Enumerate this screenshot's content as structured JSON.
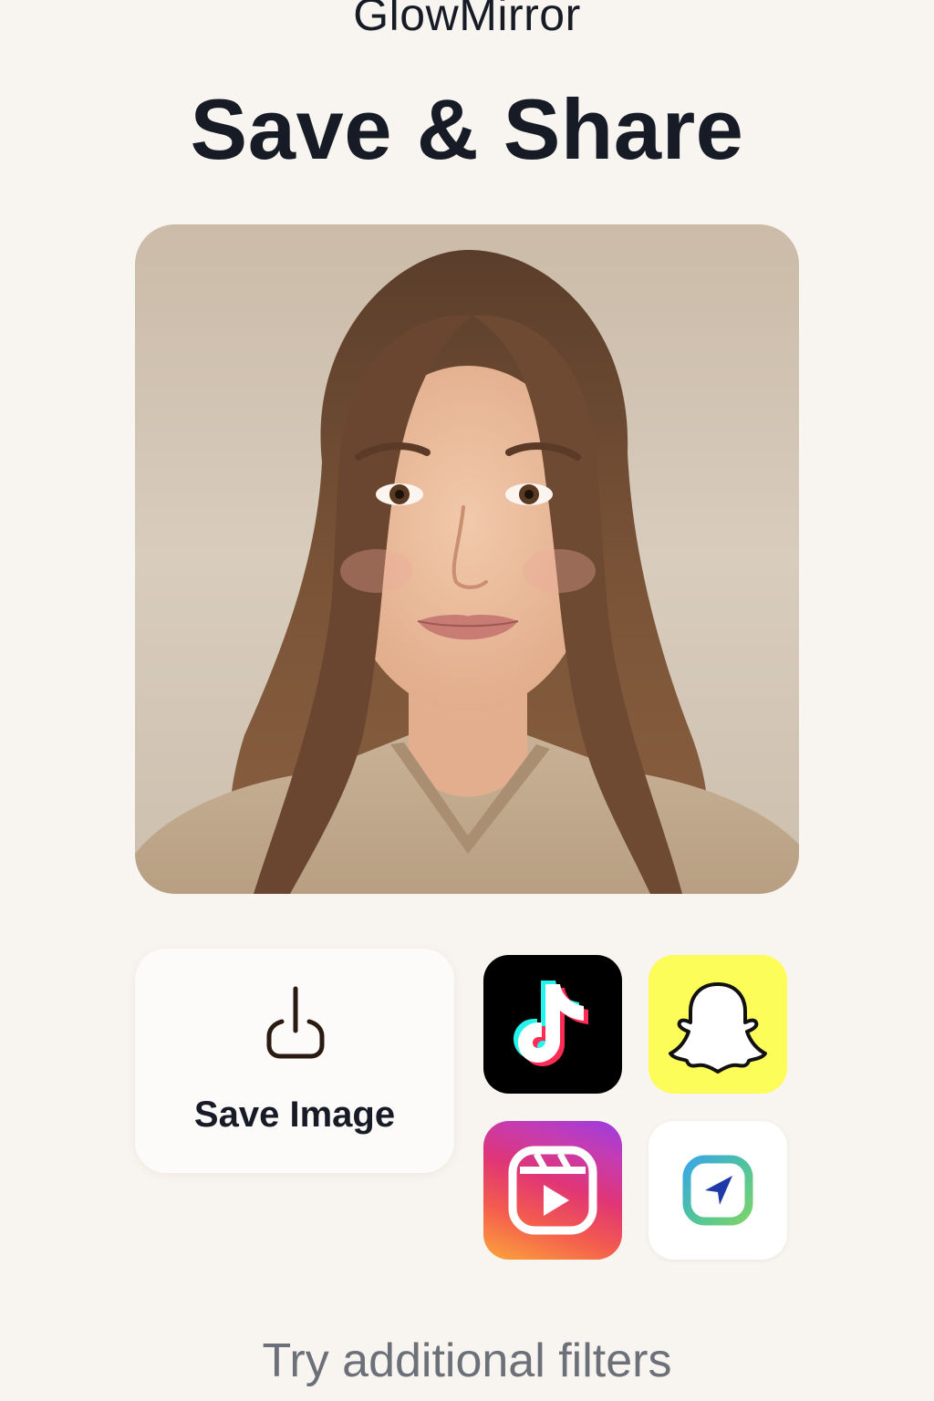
{
  "header": {
    "app_name": "GlowMirror",
    "title": "Save & Share"
  },
  "preview": {
    "image": "portrait-photo"
  },
  "actions": {
    "save_label": "Save Image",
    "save_icon": "download-icon"
  },
  "share_apps": [
    {
      "name": "TikTok",
      "icon": "tiktok-icon"
    },
    {
      "name": "Snapchat",
      "icon": "snapchat-icon"
    },
    {
      "name": "Instagram Reels",
      "icon": "reels-icon"
    },
    {
      "name": "Send",
      "icon": "send-icon"
    }
  ],
  "footer": {
    "link_text": "Try additional filters"
  },
  "colors": {
    "background": "#f8f4ef",
    "text": "#161b26",
    "muted_text": "#6b7079",
    "snapchat_yellow": "#fdfd5a"
  }
}
